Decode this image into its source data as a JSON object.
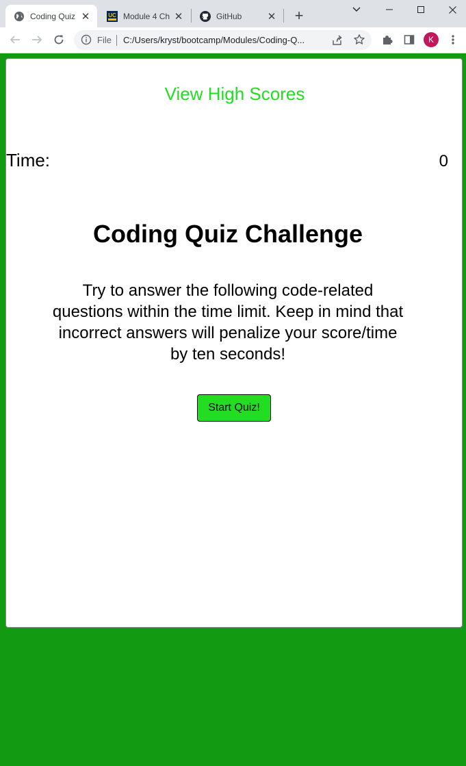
{
  "browser": {
    "tabs": [
      {
        "title": "Coding Quiz",
        "icon": "globe-icon",
        "active": true
      },
      {
        "title": "Module 4 Ch",
        "icon": "ucdavis-icon",
        "active": false
      },
      {
        "title": "GitHub",
        "icon": "github-icon",
        "active": false
      }
    ],
    "new_tab_glyph": "+",
    "close_glyph": "✕",
    "address": {
      "scheme_label": "File",
      "url": "C:/Users/kryst/bootcamp/Modules/Coding-Q..."
    },
    "profile_initial": "K",
    "colors": {
      "profile": "#c2185b"
    }
  },
  "page": {
    "high_scores_link": "View High Scores",
    "time_label": "Time:",
    "time_value": "0",
    "title": "Coding Quiz Challenge",
    "description": "Try to answer the following code-related questions within the time limit. Keep in mind that incorrect answers will penalize your score/time by ten seconds!",
    "start_button": "Start Quiz!",
    "colors": {
      "background": "#139a13",
      "accent": "#22dd22",
      "card": "#ffffff"
    }
  }
}
